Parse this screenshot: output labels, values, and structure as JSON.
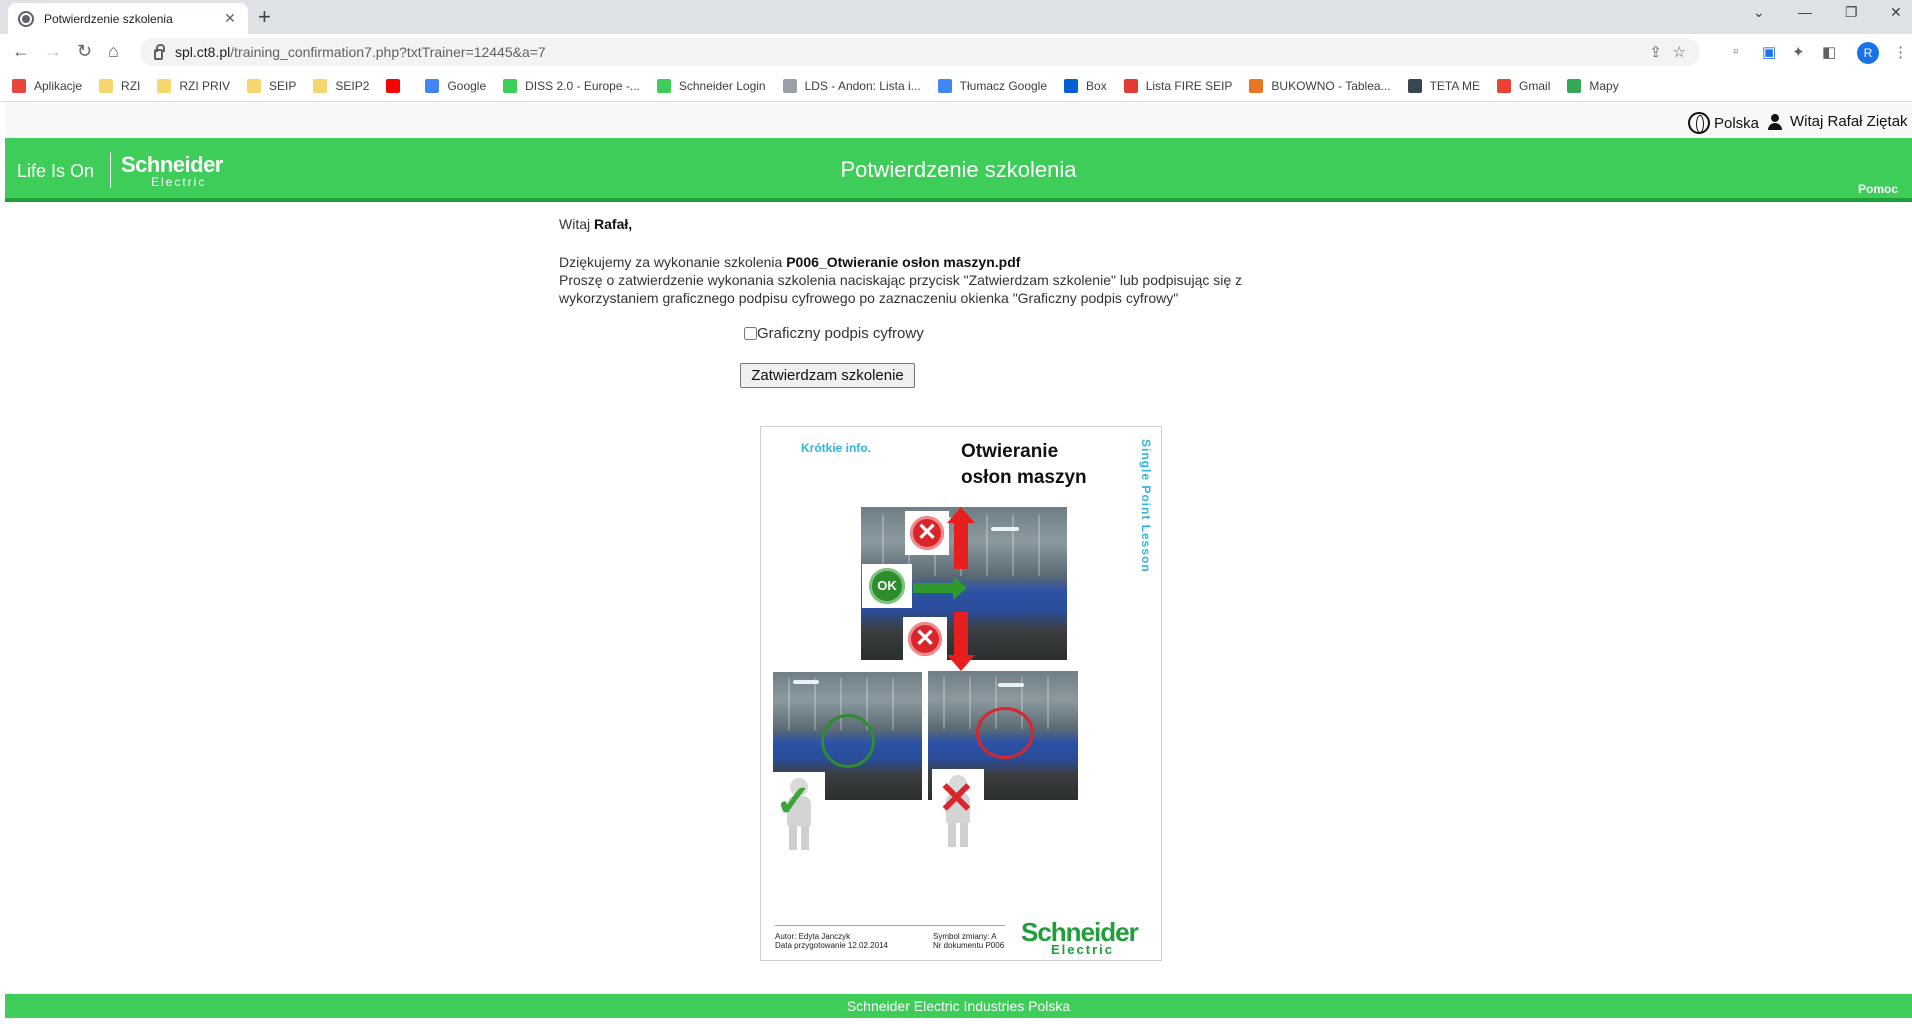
{
  "browser": {
    "tab_title": "Potwierdzenie szkolenia",
    "url_host": "spl.ct8.pl",
    "url_path": "/training_confirmation7.php?txtTrainer=12445&a=7",
    "profile_initial": "R",
    "bookmarks": [
      {
        "label": "Aplikacje",
        "icon": "apps-grid-icon",
        "color": "#e8453c"
      },
      {
        "label": "RZI",
        "icon": "folder-icon",
        "color": "#f5d76e"
      },
      {
        "label": "RZI PRIV",
        "icon": "folder-icon",
        "color": "#f5d76e"
      },
      {
        "label": "SEIP",
        "icon": "folder-icon",
        "color": "#f5d76e"
      },
      {
        "label": "SEIP2",
        "icon": "folder-icon",
        "color": "#f5d76e"
      },
      {
        "label": "",
        "icon": "youtube-icon",
        "color": "#ff0000"
      },
      {
        "label": "Google",
        "icon": "google-icon",
        "color": "#4285f4"
      },
      {
        "label": "DISS 2.0 - Europe -...",
        "icon": "diss-icon",
        "color": "#3dcd58"
      },
      {
        "label": "Schneider Login",
        "icon": "schneider-icon",
        "color": "#3dcd58"
      },
      {
        "label": "LDS - Andon: Lista i...",
        "icon": "lds-icon",
        "color": "#9aa0a6"
      },
      {
        "label": "Tłumacz Google",
        "icon": "translate-icon",
        "color": "#4285f4"
      },
      {
        "label": "Box",
        "icon": "box-icon",
        "color": "#0061d5"
      },
      {
        "label": "Lista FIRE SEIP",
        "icon": "fire-icon",
        "color": "#e53935"
      },
      {
        "label": "BUKOWNO - Tablea...",
        "icon": "tableau-icon",
        "color": "#e97627"
      },
      {
        "label": "TETA ME",
        "icon": "teta-icon",
        "color": "#37474f"
      },
      {
        "label": "Gmail",
        "icon": "gmail-icon",
        "color": "#ea4335"
      },
      {
        "label": "Mapy",
        "icon": "maps-icon",
        "color": "#34a853"
      }
    ]
  },
  "topbar": {
    "language": "Polska",
    "welcome": "Witaj Rafał Ziętak"
  },
  "header": {
    "tagline": "Life Is On",
    "logo_top": "Schneider",
    "logo_bottom": "Electric",
    "title": "Potwierdzenie szkolenia",
    "help": "Pomoc",
    "color": "#3dcd58"
  },
  "content": {
    "greeting_prefix": "Witaj",
    "greeting_name": "Rafał,",
    "thanks_prefix": "Dziękujemy za wykonanie szkolenia",
    "training_file": "P006_Otwieranie osłon maszyn.pdf",
    "instruction_line1": "Proszę o zatwierdzenie wykonania szkolenia naciskając przycisk \"Zatwierdzam szkolenie\" lub podpisując się z",
    "instruction_line2": "wykorzystaniem graficznego podpisu cyfrowego po zaznaczeniu okienka \"Graficzny podpis cyfrowy\"",
    "checkbox_label": "Graficzny podpis cyfrowy",
    "checkbox_checked": false,
    "confirm_button": "Zatwierdzam szkolenie"
  },
  "document": {
    "short_info": "Krótkie info.",
    "title_line1": "Otwieranie",
    "title_line2": "osłon maszyn",
    "side_label": "Single Point Lesson",
    "ok_label": "OK",
    "x_label": "✕",
    "author": "Autor:  Edyta Janczyk",
    "prepared": "Data przygotowanie  12.02.2014",
    "change_symbol": "Symbol zmiany:  A",
    "doc_number": "Nr dokumentu P006",
    "logo_top": "Schneider",
    "logo_bottom": "Electric"
  },
  "footer": {
    "text": "Schneider Electric Industries Polska"
  }
}
